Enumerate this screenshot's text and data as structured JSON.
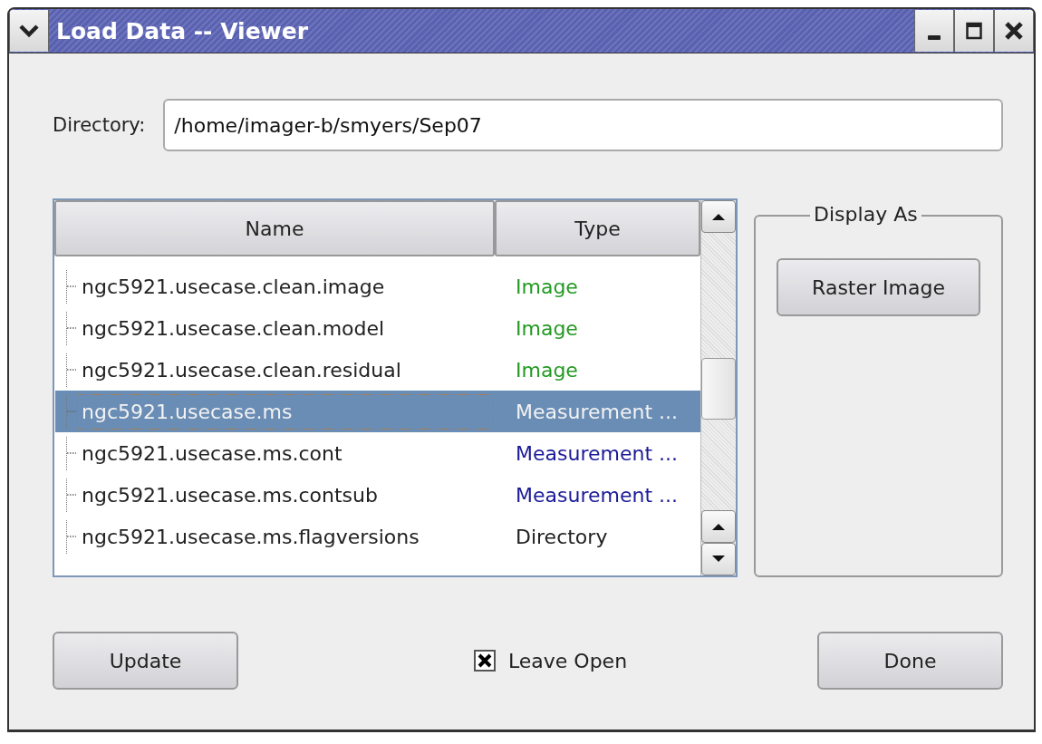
{
  "window": {
    "title": "Load Data -- Viewer"
  },
  "directory": {
    "label": "Directory:",
    "value": "/home/imager-b/smyers/Sep07"
  },
  "table": {
    "columns": [
      "Name",
      "Type"
    ],
    "rows": [
      {
        "name": "ngc5921.usecase.clean.image",
        "type": "Image",
        "kind": "image",
        "selected": false
      },
      {
        "name": "ngc5921.usecase.clean.model",
        "type": "Image",
        "kind": "image",
        "selected": false
      },
      {
        "name": "ngc5921.usecase.clean.residual",
        "type": "Image",
        "kind": "image",
        "selected": false
      },
      {
        "name": "ngc5921.usecase.ms",
        "type": "Measurement ...",
        "kind": "measurement",
        "selected": true
      },
      {
        "name": "ngc5921.usecase.ms.cont",
        "type": "Measurement ...",
        "kind": "measurement",
        "selected": false
      },
      {
        "name": "ngc5921.usecase.ms.contsub",
        "type": "Measurement ...",
        "kind": "measurement",
        "selected": false
      },
      {
        "name": "ngc5921.usecase.ms.flagversions",
        "type": "Directory",
        "kind": "directory",
        "selected": false
      }
    ]
  },
  "display_as": {
    "title": "Display As",
    "buttons": [
      "Raster Image"
    ]
  },
  "footer": {
    "update": "Update",
    "leave_open": {
      "label": "Leave Open",
      "checked": true
    },
    "done": "Done"
  }
}
